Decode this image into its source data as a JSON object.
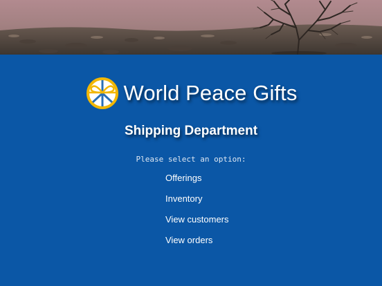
{
  "header": {
    "banner_image": "desert-tree-landscape"
  },
  "brand": {
    "logo_icon": "peace-sign-gift-bow-icon",
    "name": "World Peace Gifts"
  },
  "page": {
    "title": "Shipping Department",
    "prompt": "Please select an option:"
  },
  "menu": {
    "items": [
      {
        "label": "Offerings"
      },
      {
        "label": "Inventory"
      },
      {
        "label": "View customers"
      },
      {
        "label": "View orders"
      }
    ]
  },
  "colors": {
    "background": "#0b57a6",
    "logo_ring": "#f2b705"
  }
}
